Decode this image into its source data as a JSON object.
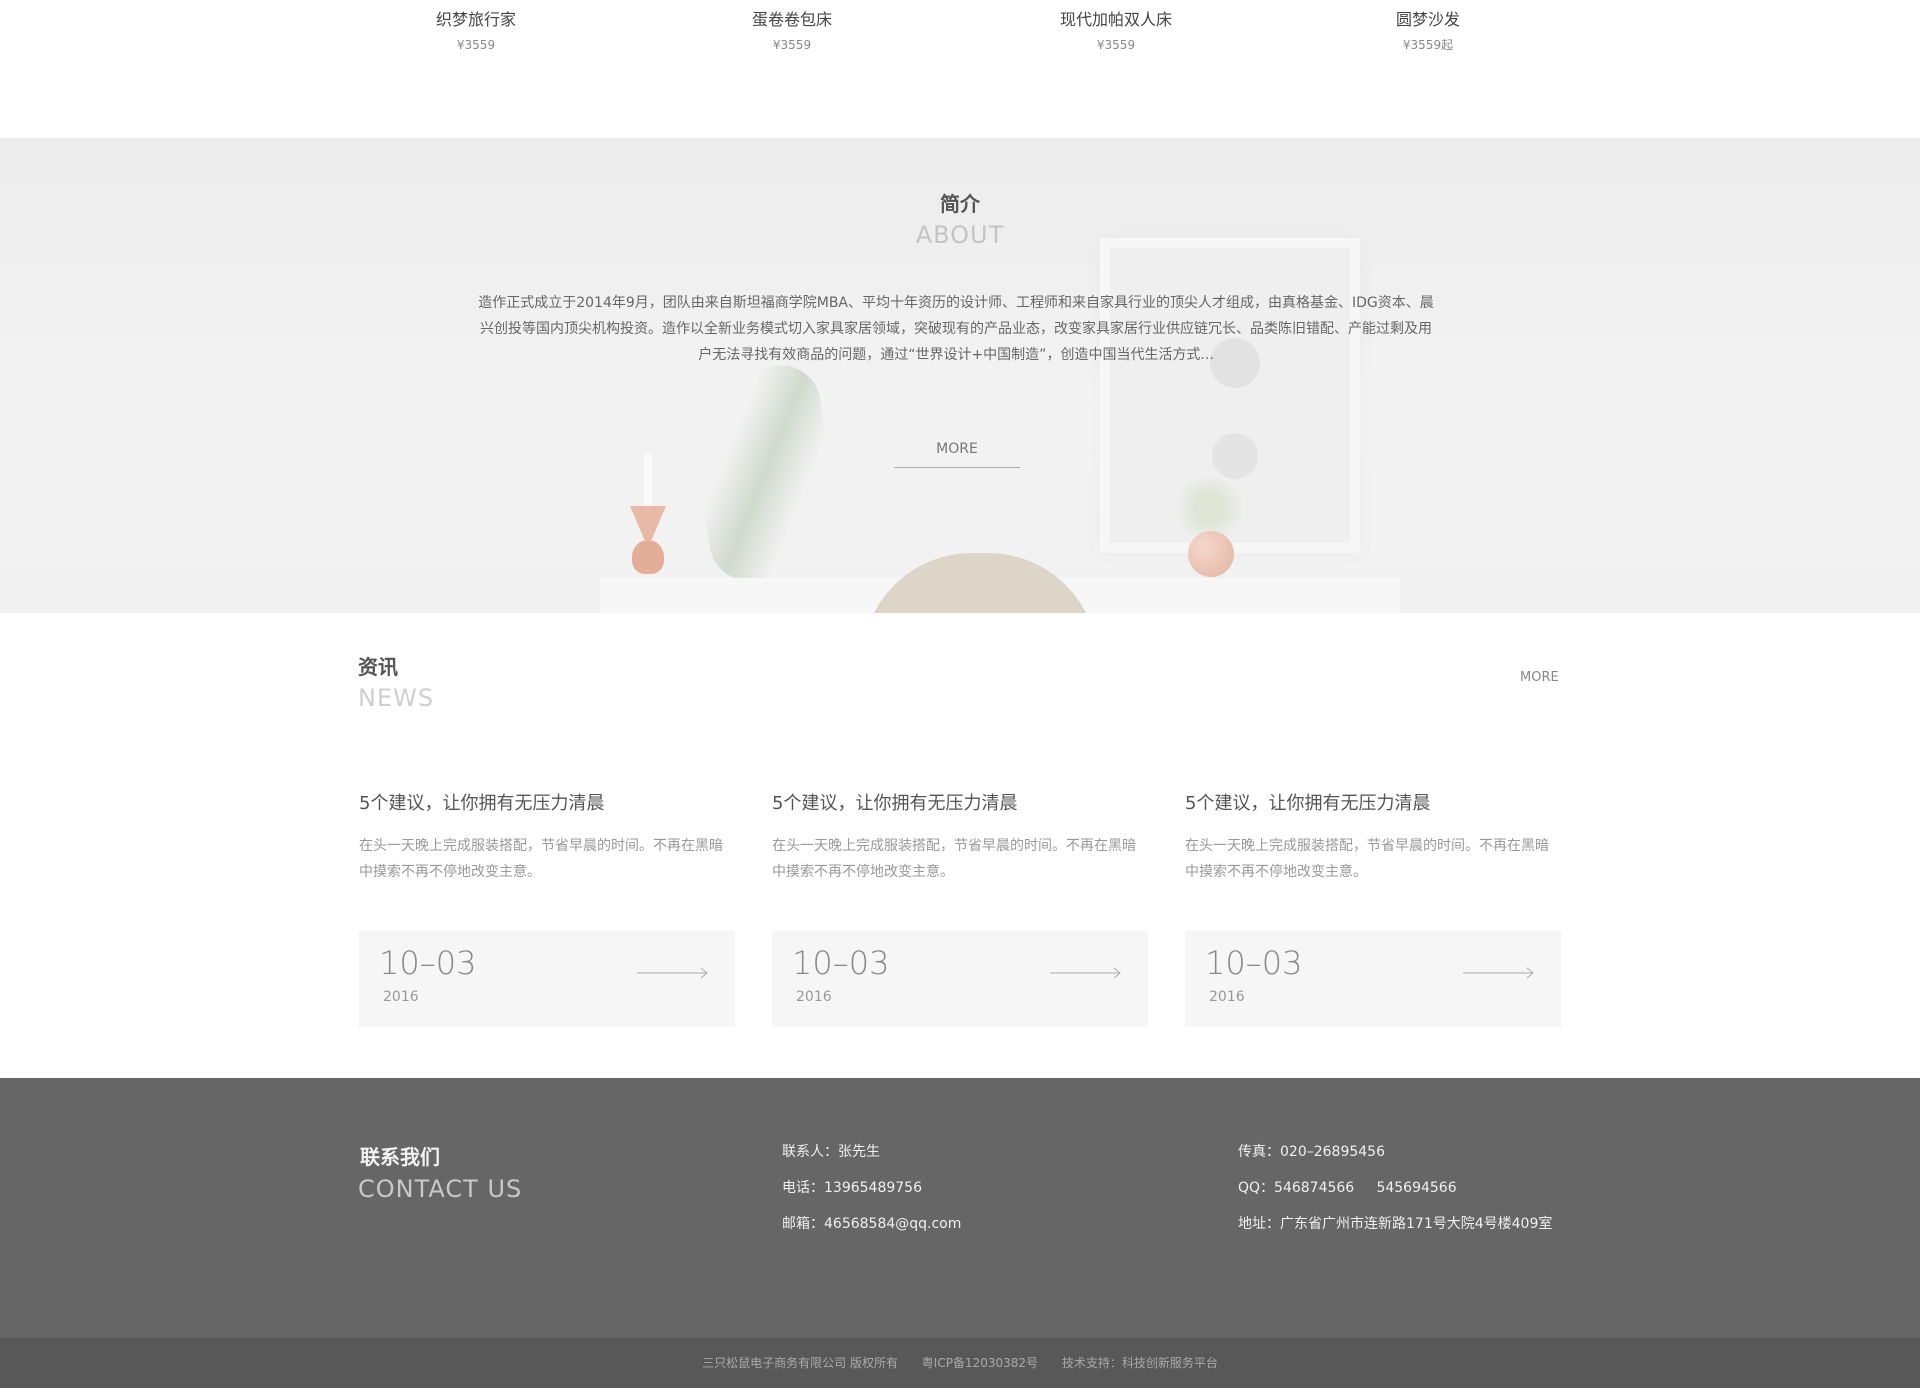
{
  "products": [
    {
      "name": "织梦旅行家",
      "price": "¥3559"
    },
    {
      "name": "蛋卷卷包床",
      "price": "¥3559"
    },
    {
      "name": "现代加帕双人床",
      "price": "¥3559"
    },
    {
      "name": "圆梦沙发",
      "price": "¥3559起"
    }
  ],
  "about": {
    "title": "简介",
    "subtitle": "ABOUT",
    "text": "造作正式成立于2014年9月，团队由来自斯坦福商学院MBA、平均十年资历的设计师、工程师和来自家具行业的顶尖人才组成，由真格基金、IDG资本、晨兴创投等国内顶尖机构投资。造作以全新业务模式切入家具家居领域，突破现有的产品业态，改变家具家居行业供应链冗长、品类陈旧错配、产能过剩及用户无法寻找有效商品的问题，通过“世界设计+中国制造”，创造中国当代生活方式...",
    "more": "MORE"
  },
  "news": {
    "title": "资讯",
    "subtitle": "NEWS",
    "more": "MORE",
    "items": [
      {
        "title": "5个建议，让你拥有无压力清晨",
        "desc": "在头一天晚上完成服装搭配，节省早晨的时间。不再在黑暗中摸索不再不停地改变主意。",
        "day": "10–03",
        "year": "2016"
      },
      {
        "title": "5个建议，让你拥有无压力清晨",
        "desc": "在头一天晚上完成服装搭配，节省早晨的时间。不再在黑暗中摸索不再不停地改变主意。",
        "day": "10–03",
        "year": "2016"
      },
      {
        "title": "5个建议，让你拥有无压力清晨",
        "desc": "在头一天晚上完成服装搭配，节省早晨的时间。不再在黑暗中摸索不再不停地改变主意。",
        "day": "10–03",
        "year": "2016"
      }
    ]
  },
  "footer": {
    "title": "联系我们",
    "subtitle": "CONTACT US",
    "contact": "联系人：张先生",
    "phone": "电话：13965489756",
    "email": "邮箱：46568584@qq.com",
    "fax": "传真：020–26895456",
    "qq": "QQ：546874566     545694566",
    "address": "地址：广东省广州市连新路171号大院4号楼409室",
    "copyright": "三只松鼠电子商务有限公司 版权所有",
    "icp": "粤ICP备12030382号",
    "support": "技术支持：科技创新服务平台"
  },
  "colors": {
    "footer_bg": "#666666",
    "bottom_bar_bg": "#585858",
    "date_box_bg": "#f6f6f6",
    "about_bg": "#efefef"
  },
  "icons": {
    "news_arrow": "arrow-right-icon"
  }
}
